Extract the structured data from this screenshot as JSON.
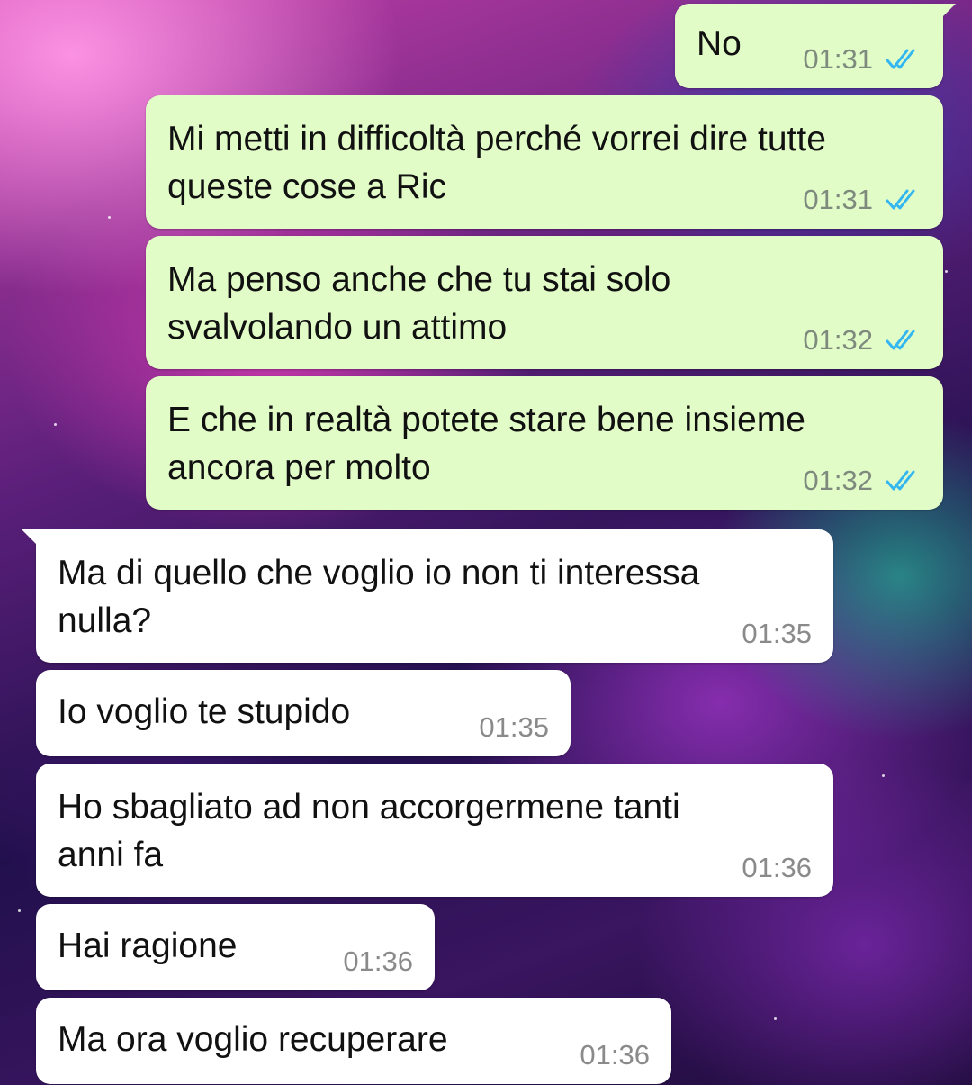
{
  "theme": {
    "outgoing_bubble": "#e2fcc7",
    "incoming_bubble": "#ffffff",
    "read_tick_color": "#34b7f1"
  },
  "messages": [
    {
      "direction": "out",
      "text": [
        "No"
      ],
      "time": "01:31",
      "status": "read-double-check-icon"
    },
    {
      "direction": "out",
      "text": [
        "Mi metti in difficoltà perché vorrei dire tutte",
        "queste cose a Ric"
      ],
      "time": "01:31",
      "status": "read-double-check-icon"
    },
    {
      "direction": "out",
      "text": [
        "Ma penso anche che tu stai solo",
        "svalvolando un attimo"
      ],
      "time": "01:32",
      "status": "read-double-check-icon"
    },
    {
      "direction": "out",
      "text": [
        "E che in realtà potete stare bene insieme",
        "ancora per molto"
      ],
      "time": "01:32",
      "status": "read-double-check-icon"
    },
    {
      "direction": "in",
      "text": [
        "Ma di quello che voglio io non ti interessa",
        "nulla?"
      ],
      "time": "01:35"
    },
    {
      "direction": "in",
      "text": [
        "Io voglio te stupido"
      ],
      "time": "01:35"
    },
    {
      "direction": "in",
      "text": [
        "Ho sbagliato ad non accorgermene tanti",
        "anni fa"
      ],
      "time": "01:36"
    },
    {
      "direction": "in",
      "text": [
        "Hai ragione"
      ],
      "time": "01:36"
    },
    {
      "direction": "in",
      "text": [
        "Ma ora voglio recuperare"
      ],
      "time": "01:36"
    }
  ]
}
